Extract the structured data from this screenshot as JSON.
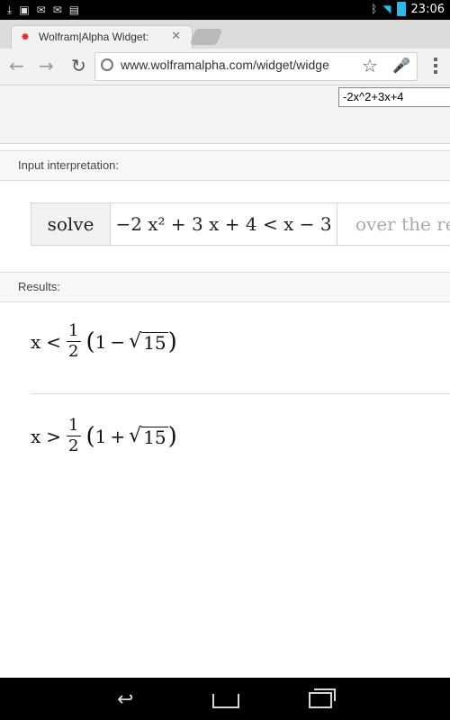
{
  "status_bar": {
    "time": "23:06",
    "icons": [
      "download-icon",
      "image-icon",
      "gmail-icon",
      "gmail-icon",
      "store-icon",
      "bluetooth-icon",
      "wifi-icon",
      "battery-icon"
    ]
  },
  "browser": {
    "tab_title": "Wolfram|Alpha Widget:",
    "url": "www.wolframalpha.com/widget/widge",
    "accent": "#d4322c"
  },
  "widget": {
    "query_value": "-2x^2+3x+4"
  },
  "input_interpretation": {
    "header": "Input interpretation:",
    "command": "solve",
    "expression": "−2 x² + 3 x + 4 < x − 3",
    "domain": "over the rea"
  },
  "results": {
    "header": "Results:",
    "items": [
      {
        "var": "x",
        "op": "<",
        "num": "1",
        "den": "2",
        "inner_left": "1",
        "sign": "−",
        "radicand": "15"
      },
      {
        "var": "x",
        "op": ">",
        "num": "1",
        "den": "2",
        "inner_left": "1",
        "sign": "+",
        "radicand": "15"
      }
    ]
  }
}
